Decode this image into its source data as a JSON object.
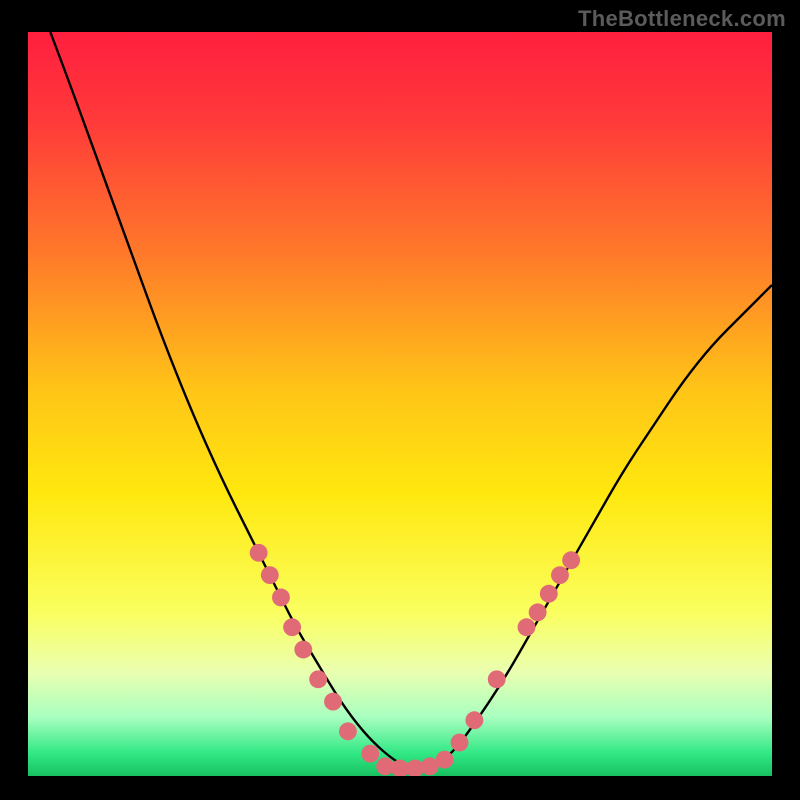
{
  "watermark": "TheBottleneck.com",
  "chart_data": {
    "type": "line",
    "title": "",
    "xlabel": "",
    "ylabel": "",
    "xlim": [
      0,
      100
    ],
    "ylim": [
      0,
      100
    ],
    "grid": false,
    "legend": false,
    "gradient_stops": [
      {
        "offset": 0.0,
        "color": "#ff1f3f"
      },
      {
        "offset": 0.12,
        "color": "#ff3a3a"
      },
      {
        "offset": 0.3,
        "color": "#ff7a2a"
      },
      {
        "offset": 0.48,
        "color": "#ffc417"
      },
      {
        "offset": 0.62,
        "color": "#ffe80e"
      },
      {
        "offset": 0.78,
        "color": "#faff5f"
      },
      {
        "offset": 0.86,
        "color": "#eaffb0"
      },
      {
        "offset": 0.92,
        "color": "#aaffc0"
      },
      {
        "offset": 0.97,
        "color": "#30e884"
      },
      {
        "offset": 1.0,
        "color": "#18c060"
      }
    ],
    "series": [
      {
        "name": "bottleneck-curve",
        "x": [
          3,
          6,
          10,
          14,
          18,
          22,
          26,
          30,
          33,
          36,
          39,
          42,
          45,
          48,
          51,
          54,
          57,
          60,
          64,
          68,
          72,
          76,
          80,
          84,
          88,
          92,
          96,
          100
        ],
        "y": [
          100,
          92,
          81,
          70,
          59,
          49,
          40,
          32,
          26,
          20,
          15,
          10,
          6,
          3,
          1,
          1,
          3,
          7,
          13,
          20,
          27,
          34,
          41,
          47,
          53,
          58,
          62,
          66
        ]
      }
    ],
    "markers": {
      "color": "#e06a75",
      "radius": 1.2,
      "points": [
        {
          "x": 31,
          "y": 30
        },
        {
          "x": 32.5,
          "y": 27
        },
        {
          "x": 34,
          "y": 24
        },
        {
          "x": 35.5,
          "y": 20
        },
        {
          "x": 37,
          "y": 17
        },
        {
          "x": 39,
          "y": 13
        },
        {
          "x": 41,
          "y": 10
        },
        {
          "x": 43,
          "y": 6
        },
        {
          "x": 46,
          "y": 3
        },
        {
          "x": 48,
          "y": 1.3
        },
        {
          "x": 50,
          "y": 1
        },
        {
          "x": 52,
          "y": 1
        },
        {
          "x": 54,
          "y": 1.3
        },
        {
          "x": 56,
          "y": 2.2
        },
        {
          "x": 58,
          "y": 4.5
        },
        {
          "x": 60,
          "y": 7.5
        },
        {
          "x": 63,
          "y": 13
        },
        {
          "x": 67,
          "y": 20
        },
        {
          "x": 68.5,
          "y": 22
        },
        {
          "x": 70,
          "y": 24.5
        },
        {
          "x": 71.5,
          "y": 27
        },
        {
          "x": 73,
          "y": 29
        }
      ]
    }
  }
}
